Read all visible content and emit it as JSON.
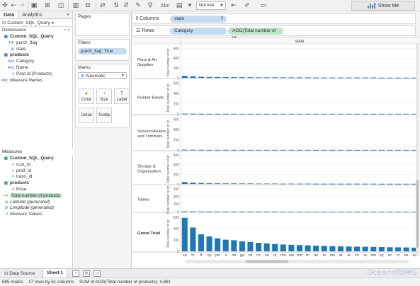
{
  "toolbar": {
    "view_dropdown": "Normal",
    "show_me_label": "Show Me",
    "abc_label": "Abc"
  },
  "left_pane": {
    "tab_data": "Data",
    "tab_analytics": "Analytics",
    "datasource": "Custom_SQL_Query",
    "dimensions_header": "Dimensions",
    "dimensions": [
      {
        "icon": "table-icon",
        "label": "Custom_SQL_Query",
        "bold": true,
        "italic": false,
        "indent": 0
      },
      {
        "icon": "tf-icon",
        "label": "purch_flag",
        "bold": false,
        "italic": false,
        "indent": 1
      },
      {
        "icon": "globe-icon",
        "label": "state",
        "bold": false,
        "italic": false,
        "indent": 1
      },
      {
        "icon": "table-icon",
        "label": "products",
        "bold": true,
        "italic": false,
        "indent": 0
      },
      {
        "icon": "abc-icon",
        "label": "Category",
        "bold": false,
        "italic": false,
        "indent": 1
      },
      {
        "icon": "abc-icon",
        "label": "Name",
        "bold": false,
        "italic": false,
        "indent": 1
      },
      {
        "icon": "hash-icon",
        "label": "Prod Id (Products)",
        "bold": false,
        "italic": false,
        "indent": 1
      },
      {
        "icon": "abc-icon",
        "label": "Measure Names",
        "bold": false,
        "italic": true,
        "indent": 0
      }
    ],
    "measures_header": "Measures",
    "measures": [
      {
        "icon": "table-icon",
        "label": "Custom_SQL_Query",
        "bold": true,
        "italic": false,
        "indent": 0
      },
      {
        "icon": "hash-icon",
        "label": "cust_id",
        "bold": false,
        "italic": false,
        "indent": 1
      },
      {
        "icon": "hash-icon",
        "label": "prod_id",
        "bold": false,
        "italic": false,
        "indent": 1
      },
      {
        "icon": "hash-icon",
        "label": "trans_id",
        "bold": false,
        "italic": false,
        "indent": 1
      },
      {
        "icon": "table-icon",
        "label": "products",
        "bold": true,
        "italic": false,
        "indent": 0
      },
      {
        "icon": "hash-icon",
        "label": "Price",
        "bold": false,
        "italic": false,
        "indent": 1
      },
      {
        "icon": "calc-icon",
        "label": "Total number of products",
        "bold": false,
        "italic": false,
        "indent": 0,
        "highlight": true
      },
      {
        "icon": "globe-icon",
        "label": "Latitude (generated)",
        "bold": false,
        "italic": true,
        "indent": 0
      },
      {
        "icon": "globe-icon",
        "label": "Longitude (generated)",
        "bold": false,
        "italic": true,
        "indent": 0
      },
      {
        "icon": "hash-icon",
        "label": "Measure Values",
        "bold": false,
        "italic": true,
        "indent": 0
      }
    ]
  },
  "cards": {
    "pages_title": "Pages",
    "filters_title": "Filters",
    "filter_pill": "purch_flag: True",
    "marks_title": "Marks",
    "marks_type": "Automatic",
    "mark_buttons": [
      "Color",
      "Size",
      "Label",
      "Detail",
      "Tooltip"
    ]
  },
  "shelves": {
    "columns_label": "Columns",
    "columns_pill": "state",
    "rows_label": "Rows",
    "rows_pills": [
      "Category",
      "AGG(Total number of pr.."
    ]
  },
  "chart_data": {
    "type": "bar",
    "column_header": "state",
    "row_header": "Category",
    "ylabel": "Total number of pr..",
    "categories": [
      "ca",
      "tx",
      "fl",
      "ny",
      "pa",
      "il",
      "oh",
      "ga",
      "mi",
      "nc",
      "va",
      "nj",
      "ma",
      "wa",
      "md",
      "tn",
      "az",
      "in",
      "mo",
      "wi",
      "al",
      "co",
      "la",
      "mn",
      "ky",
      "sc",
      "ct",
      "ok",
      "ks"
    ],
    "yticks": [
      0,
      200,
      400,
      600
    ],
    "ylim": [
      0,
      650
    ],
    "series": [
      {
        "name": "Pens & Art Supplies",
        "values": [
          40,
          30,
          22,
          18,
          16,
          14,
          14,
          12,
          12,
          10,
          10,
          10,
          8,
          8,
          8,
          8,
          6,
          6,
          6,
          6,
          6,
          6,
          6,
          6,
          4,
          4,
          4,
          4,
          4
        ]
      },
      {
        "name": "Rubber Bands",
        "values": [
          6,
          5,
          4,
          3,
          3,
          3,
          3,
          2,
          2,
          2,
          2,
          2,
          2,
          2,
          2,
          2,
          2,
          2,
          2,
          2,
          2,
          2,
          2,
          2,
          2,
          2,
          2,
          2,
          2
        ]
      },
      {
        "name": "Scissors/Rulers and Trimmers",
        "values": [
          6,
          5,
          4,
          3,
          3,
          3,
          3,
          2,
          2,
          2,
          2,
          2,
          2,
          2,
          2,
          2,
          2,
          2,
          2,
          2,
          2,
          2,
          2,
          2,
          2,
          2,
          2,
          2,
          2
        ]
      },
      {
        "name": "Storage & Organization",
        "values": [
          40,
          30,
          22,
          18,
          16,
          14,
          14,
          12,
          12,
          10,
          10,
          10,
          8,
          8,
          8,
          8,
          6,
          6,
          6,
          6,
          6,
          6,
          6,
          6,
          4,
          4,
          4,
          4,
          4
        ]
      },
      {
        "name": "Tables",
        "values": [
          10,
          8,
          6,
          5,
          4,
          4,
          4,
          3,
          3,
          3,
          3,
          3,
          2,
          2,
          2,
          2,
          2,
          2,
          2,
          2,
          2,
          2,
          2,
          2,
          2,
          2,
          2,
          2,
          2
        ]
      },
      {
        "name": "Grand Total",
        "values": [
          590,
          420,
          300,
          265,
          230,
          205,
          195,
          175,
          165,
          150,
          140,
          130,
          120,
          115,
          110,
          105,
          100,
          95,
          90,
          88,
          85,
          82,
          80,
          78,
          75,
          72,
          70,
          68,
          65
        ]
      }
    ],
    "bar_color": "#1f77b4"
  },
  "bottom": {
    "data_source_tab": "Data Source",
    "sheet_tab": "Sheet 1"
  },
  "status": {
    "marks": "685 marks",
    "rows_cols": "17 rows by 51 columns",
    "sum": "SUM of AGG(Total number of products): 4,861"
  },
  "watermark": "OceanofDMG"
}
